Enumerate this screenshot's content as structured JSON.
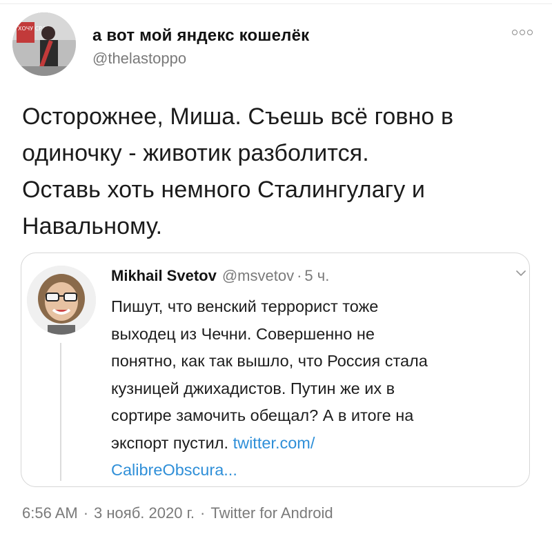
{
  "tweet": {
    "author": {
      "display_name": "а вот мой яндекс кошелёк",
      "handle": "@thelastoppo",
      "avatar_icon": "avatar-photo-icon",
      "avatar_sign_text": "ХОЧУ СРАТЬ"
    },
    "more_icon": "more-dots-icon",
    "text_lines": [
      "Осторожнее, Миша. Съешь всё говно в",
      "одиночку - животик разболится.",
      "Оставь хоть немного Сталингулагу и",
      "Навальному."
    ],
    "quoted": {
      "author_name": "Mikhail Svetov",
      "handle": "@msvetov",
      "separator": "·",
      "time": "5 ч.",
      "avatar_icon": "avatar-photo-icon",
      "chevron_icon": "chevron-down-icon",
      "text_lines": [
        "Пишут, что венский террорист тоже",
        "выходец из Чечни. Совершенно не",
        "понятно, как так вышло, что Россия стала",
        "кузницей джихадистов. Путин же их в",
        "сортире замочить обещал? А в итоге на",
        "экспорт пустил. "
      ],
      "link_part1": "twitter.com/",
      "link_part2": "CalibreObscura..."
    },
    "footer": {
      "time": "6:56 AM",
      "date": "3 нояб. 2020 г.",
      "source": "Twitter for Android",
      "separator": "·"
    }
  },
  "colors": {
    "text": "#1b1b1b",
    "secondary": "#7a7a7a",
    "link": "#2f8fd8",
    "border": "#d6d6d6"
  }
}
